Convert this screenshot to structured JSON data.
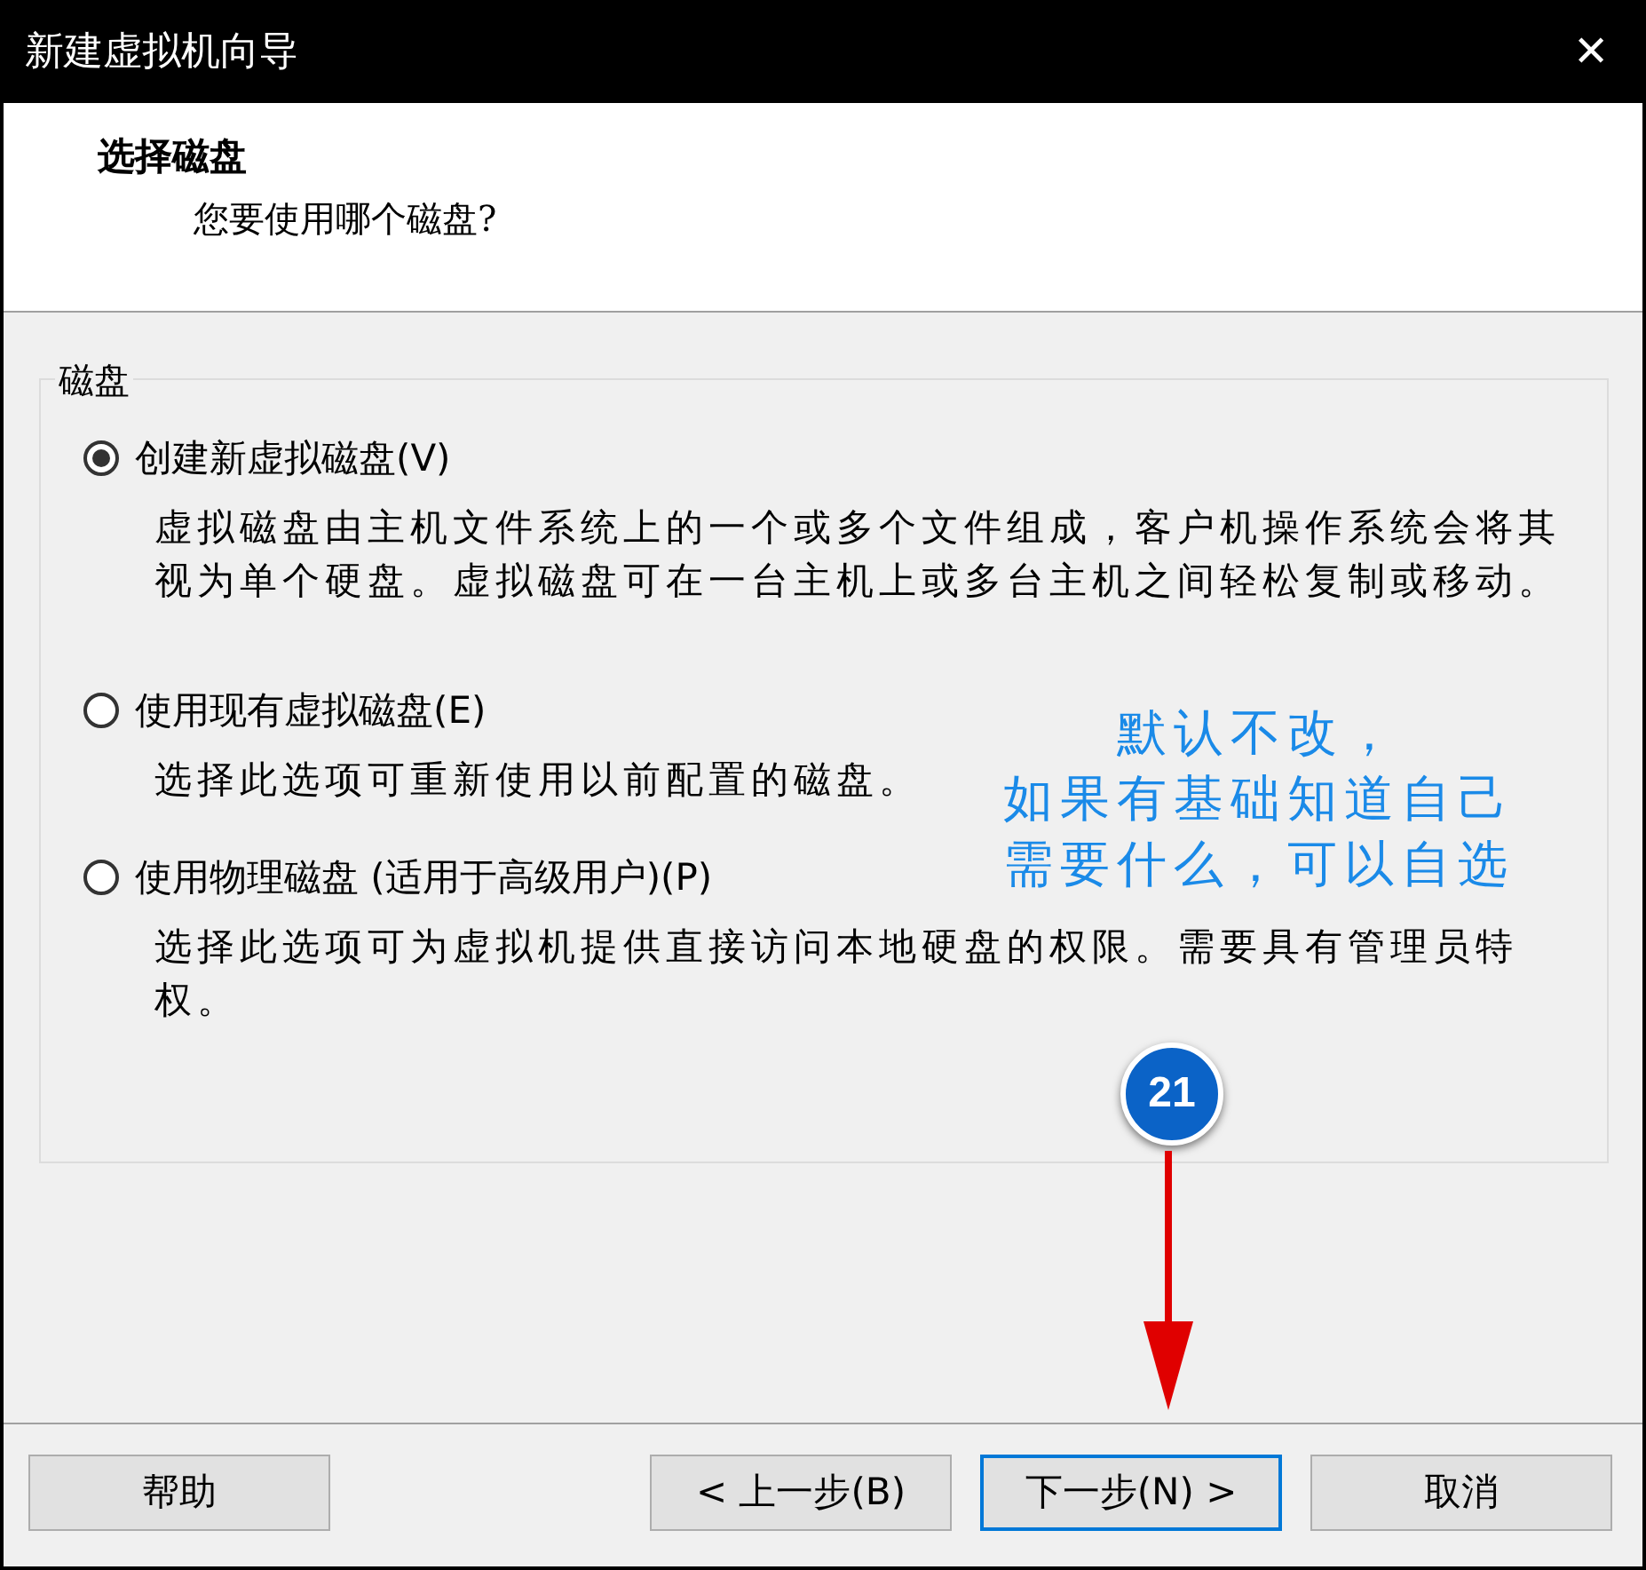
{
  "window": {
    "title": "新建虚拟机向导",
    "close": "✕"
  },
  "header": {
    "title": "选择磁盘",
    "subtitle": "您要使用哪个磁盘?"
  },
  "group": {
    "label": "磁盘",
    "options": [
      {
        "label": "创建新虚拟磁盘(V)",
        "selected": true,
        "description": "虚拟磁盘由主机文件系统上的一个或多个文件组成，客户机操作系统会将其视为单个硬盘。虚拟磁盘可在一台主机上或多台主机之间轻松复制或移动。"
      },
      {
        "label": "使用现有虚拟磁盘(E)",
        "selected": false,
        "description": "选择此选项可重新使用以前配置的磁盘。"
      },
      {
        "label": "使用物理磁盘 (适用于高级用户)(P)",
        "selected": false,
        "description": "选择此选项可为虚拟机提供直接访问本地硬盘的权限。需要具有管理员特权。"
      }
    ]
  },
  "annotation": {
    "lines": [
      "默认不改，",
      "如果有基础知道自己",
      "需要什么，可以自选"
    ],
    "badge": "21"
  },
  "buttons": [
    {
      "label": "帮助",
      "default": false
    },
    {
      "label": "< 上一步(B)",
      "default": false
    },
    {
      "label": "下一步(N) >",
      "default": true
    },
    {
      "label": "取消",
      "default": false
    }
  ]
}
